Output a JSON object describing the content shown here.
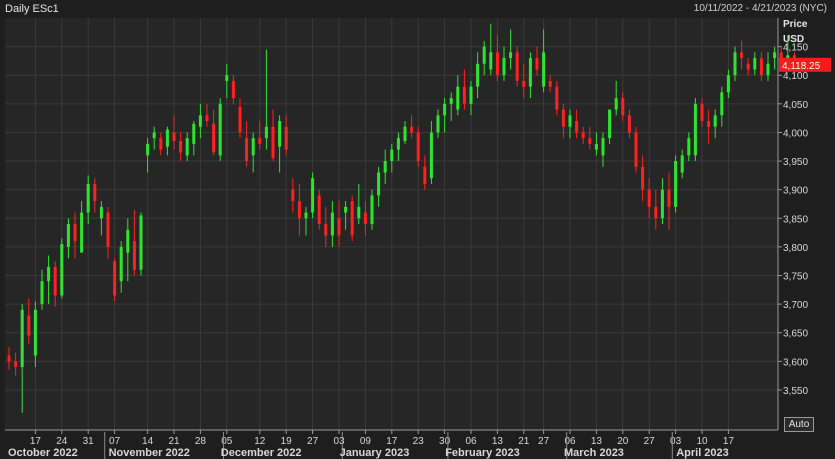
{
  "header": {
    "symbol": "Daily ESc1",
    "range": "10/11/2022 - 4/21/2023 (NYC)"
  },
  "axis": {
    "price_label": "Price",
    "currency_label": "USD",
    "auto_label": "Auto"
  },
  "colors": {
    "background": "#1e1e1e",
    "plot_background": "#262626",
    "grid": "#3a3a3a",
    "up": "#2ee52e",
    "down": "#ff2020",
    "text": "#d8d8d8",
    "last_price_bg": "#ff1a1a"
  },
  "chart_data": {
    "type": "candlestick",
    "title": "Daily ESc1",
    "ylabel": "Price USD",
    "ylim": [
      3480,
      4200
    ],
    "y_ticks": [
      "3,550",
      "3,600",
      "3,650",
      "3,700",
      "3,750",
      "3,800",
      "3,850",
      "3,900",
      "3,950",
      "4,000",
      "4,050",
      "4,100",
      "4,150"
    ],
    "y_tick_values": [
      3550,
      3600,
      3650,
      3700,
      3750,
      3800,
      3850,
      3900,
      3950,
      4000,
      4050,
      4100,
      4150
    ],
    "last_price": "4,118.25",
    "last_price_value": 4118.25,
    "x_day_ticks": [
      {
        "i": 4,
        "label": "17"
      },
      {
        "i": 8,
        "label": "24"
      },
      {
        "i": 12,
        "label": "31"
      },
      {
        "i": 16,
        "label": "07"
      },
      {
        "i": 21,
        "label": "14"
      },
      {
        "i": 25,
        "label": "21"
      },
      {
        "i": 29,
        "label": "28"
      },
      {
        "i": 33,
        "label": "05"
      },
      {
        "i": 38,
        "label": "12"
      },
      {
        "i": 42,
        "label": "19"
      },
      {
        "i": 46,
        "label": "27"
      },
      {
        "i": 50,
        "label": "03"
      },
      {
        "i": 54,
        "label": "09"
      },
      {
        "i": 58,
        "label": "17"
      },
      {
        "i": 62,
        "label": "23"
      },
      {
        "i": 66,
        "label": "30"
      },
      {
        "i": 70,
        "label": "06"
      },
      {
        "i": 74,
        "label": "13"
      },
      {
        "i": 78,
        "label": "21"
      },
      {
        "i": 81,
        "label": "27"
      },
      {
        "i": 85,
        "label": "06"
      },
      {
        "i": 89,
        "label": "13"
      },
      {
        "i": 93,
        "label": "20"
      },
      {
        "i": 97,
        "label": "27"
      },
      {
        "i": 101,
        "label": "03"
      },
      {
        "i": 105,
        "label": "10"
      },
      {
        "i": 109,
        "label": "17"
      }
    ],
    "x_month_labels": [
      {
        "i": 0,
        "label": "October 2022"
      },
      {
        "i": 16,
        "label": "November 2022"
      },
      {
        "i": 33,
        "label": "December 2022"
      },
      {
        "i": 51,
        "label": "January 2023"
      },
      {
        "i": 67,
        "label": "February 2023"
      },
      {
        "i": 85,
        "label": "March 2023"
      },
      {
        "i": 102,
        "label": "April 2023"
      }
    ],
    "month_separators": [
      14,
      32,
      50,
      66,
      84,
      100
    ],
    "candles": [
      [
        3610,
        3625,
        3585,
        3600
      ],
      [
        3600,
        3615,
        3575,
        3590
      ],
      [
        3590,
        3700,
        3510,
        3690
      ],
      [
        3680,
        3710,
        3630,
        3645
      ],
      [
        3610,
        3705,
        3590,
        3690
      ],
      [
        3700,
        3760,
        3690,
        3740
      ],
      [
        3740,
        3785,
        3700,
        3765
      ],
      [
        3765,
        3775,
        3695,
        3715
      ],
      [
        3715,
        3815,
        3710,
        3805
      ],
      [
        3800,
        3850,
        3780,
        3840
      ],
      [
        3840,
        3860,
        3780,
        3810
      ],
      [
        3790,
        3880,
        3790,
        3860
      ],
      [
        3860,
        3925,
        3840,
        3910
      ],
      [
        3910,
        3920,
        3860,
        3880
      ],
      [
        3850,
        3880,
        3820,
        3870
      ],
      [
        3860,
        3870,
        3780,
        3800
      ],
      [
        3775,
        3780,
        3705,
        3715
      ],
      [
        3740,
        3810,
        3720,
        3800
      ],
      [
        3790,
        3850,
        3740,
        3830
      ],
      [
        3810,
        3865,
        3750,
        3760
      ],
      [
        3760,
        3860,
        3750,
        3855
      ],
      [
        3960,
        3990,
        3930,
        3980
      ],
      [
        3990,
        4010,
        3970,
        4000
      ],
      [
        3990,
        4000,
        3960,
        3970
      ],
      [
        3975,
        4010,
        3960,
        4005
      ],
      [
        4000,
        4030,
        3970,
        3985
      ],
      [
        3985,
        4000,
        3950,
        3965
      ],
      [
        3960,
        4000,
        3950,
        3990
      ],
      [
        3980,
        4020,
        3960,
        4015
      ],
      [
        4010,
        4050,
        3990,
        4030
      ],
      [
        4030,
        4050,
        4010,
        4020
      ],
      [
        4015,
        4040,
        3960,
        3965
      ],
      [
        3960,
        4060,
        3950,
        4050
      ],
      [
        4090,
        4120,
        4060,
        4100
      ],
      [
        4090,
        4100,
        4050,
        4060
      ],
      [
        4045,
        4060,
        3990,
        4000
      ],
      [
        3990,
        4020,
        3940,
        3950
      ],
      [
        3960,
        4000,
        3930,
        3990
      ],
      [
        3990,
        4020,
        3970,
        3980
      ],
      [
        3990,
        4145,
        3970,
        4010
      ],
      [
        4010,
        4040,
        3950,
        3955
      ],
      [
        3975,
        4030,
        3930,
        4020
      ],
      [
        4010,
        4030,
        3960,
        3970
      ],
      [
        3900,
        3920,
        3860,
        3880
      ],
      [
        3880,
        3910,
        3820,
        3850
      ],
      [
        3850,
        3870,
        3820,
        3860
      ],
      [
        3860,
        3930,
        3850,
        3920
      ],
      [
        3890,
        3900,
        3830,
        3840
      ],
      [
        3840,
        3870,
        3800,
        3820
      ],
      [
        3820,
        3880,
        3800,
        3860
      ],
      [
        3850,
        3880,
        3800,
        3820
      ],
      [
        3860,
        3880,
        3830,
        3870
      ],
      [
        3880,
        3890,
        3810,
        3820
      ],
      [
        3850,
        3910,
        3840,
        3870
      ],
      [
        3860,
        3880,
        3820,
        3840
      ],
      [
        3840,
        3900,
        3830,
        3890
      ],
      [
        3890,
        3940,
        3870,
        3930
      ],
      [
        3930,
        3970,
        3910,
        3950
      ],
      [
        3950,
        3980,
        3930,
        3970
      ],
      [
        3970,
        4000,
        3950,
        3990
      ],
      [
        3985,
        4020,
        3980,
        4010
      ],
      [
        4010,
        4030,
        3990,
        4000
      ],
      [
        4000,
        4010,
        3940,
        3950
      ],
      [
        3940,
        3960,
        3900,
        3910
      ],
      [
        3920,
        4020,
        3910,
        4000
      ],
      [
        4000,
        4040,
        3990,
        4030
      ],
      [
        4030,
        4060,
        4000,
        4050
      ],
      [
        4050,
        4070,
        4020,
        4060
      ],
      [
        4040,
        4100,
        4030,
        4080
      ],
      [
        4080,
        4110,
        4040,
        4050
      ],
      [
        4050,
        4090,
        4030,
        4080
      ],
      [
        4080,
        4140,
        4060,
        4120
      ],
      [
        4120,
        4160,
        4100,
        4150
      ],
      [
        4110,
        4190,
        4100,
        4140
      ],
      [
        4140,
        4170,
        4090,
        4100
      ],
      [
        4100,
        4150,
        4090,
        4130
      ],
      [
        4130,
        4180,
        4110,
        4140
      ],
      [
        4140,
        4150,
        4080,
        4090
      ],
      [
        4090,
        4120,
        4060,
        4080
      ],
      [
        4080,
        4140,
        4060,
        4130
      ],
      [
        4130,
        4150,
        4100,
        4110
      ],
      [
        4080,
        4180,
        4070,
        4140
      ],
      [
        4090,
        4100,
        4070,
        4080
      ],
      [
        4080,
        4090,
        4030,
        4040
      ],
      [
        4040,
        4050,
        3990,
        4010
      ],
      [
        4010,
        4040,
        3990,
        4030
      ],
      [
        4020,
        4040,
        3990,
        4000
      ],
      [
        4000,
        4010,
        3980,
        3990
      ],
      [
        3990,
        4010,
        3970,
        3980
      ],
      [
        3970,
        4000,
        3960,
        3980
      ],
      [
        3960,
        4000,
        3940,
        3990
      ],
      [
        3990,
        4030,
        3980,
        4040
      ],
      [
        4040,
        4090,
        4030,
        4060
      ],
      [
        4060,
        4070,
        4020,
        4030
      ],
      [
        4030,
        4040,
        3990,
        4000
      ],
      [
        4000,
        4010,
        3930,
        3940
      ],
      [
        3940,
        3960,
        3880,
        3900
      ],
      [
        3900,
        3920,
        3850,
        3870
      ],
      [
        3870,
        3900,
        3830,
        3850
      ],
      [
        3850,
        3920,
        3840,
        3900
      ],
      [
        3900,
        3930,
        3830,
        3870
      ],
      [
        3870,
        3960,
        3860,
        3950
      ],
      [
        3930,
        3970,
        3920,
        3960
      ],
      [
        3960,
        4000,
        3950,
        3990
      ],
      [
        3960,
        4060,
        3950,
        4050
      ],
      [
        4050,
        4060,
        4010,
        4020
      ],
      [
        4020,
        4040,
        3980,
        4010
      ],
      [
        4010,
        4040,
        3990,
        4030
      ],
      [
        4030,
        4080,
        4010,
        4070
      ],
      [
        4070,
        4110,
        4060,
        4100
      ],
      [
        4100,
        4150,
        4090,
        4140
      ],
      [
        4140,
        4160,
        4110,
        4130
      ],
      [
        4120,
        4130,
        4100,
        4110
      ],
      [
        4110,
        4140,
        4100,
        4130
      ],
      [
        4130,
        4140,
        4090,
        4100
      ],
      [
        4100,
        4140,
        4090,
        4120
      ],
      [
        4130,
        4150,
        4110,
        4140
      ],
      [
        4140,
        4150,
        4120,
        4130
      ],
      [
        4130,
        4170,
        4110,
        4135
      ],
      [
        4135,
        4140,
        4105,
        4118.25
      ]
    ]
  }
}
